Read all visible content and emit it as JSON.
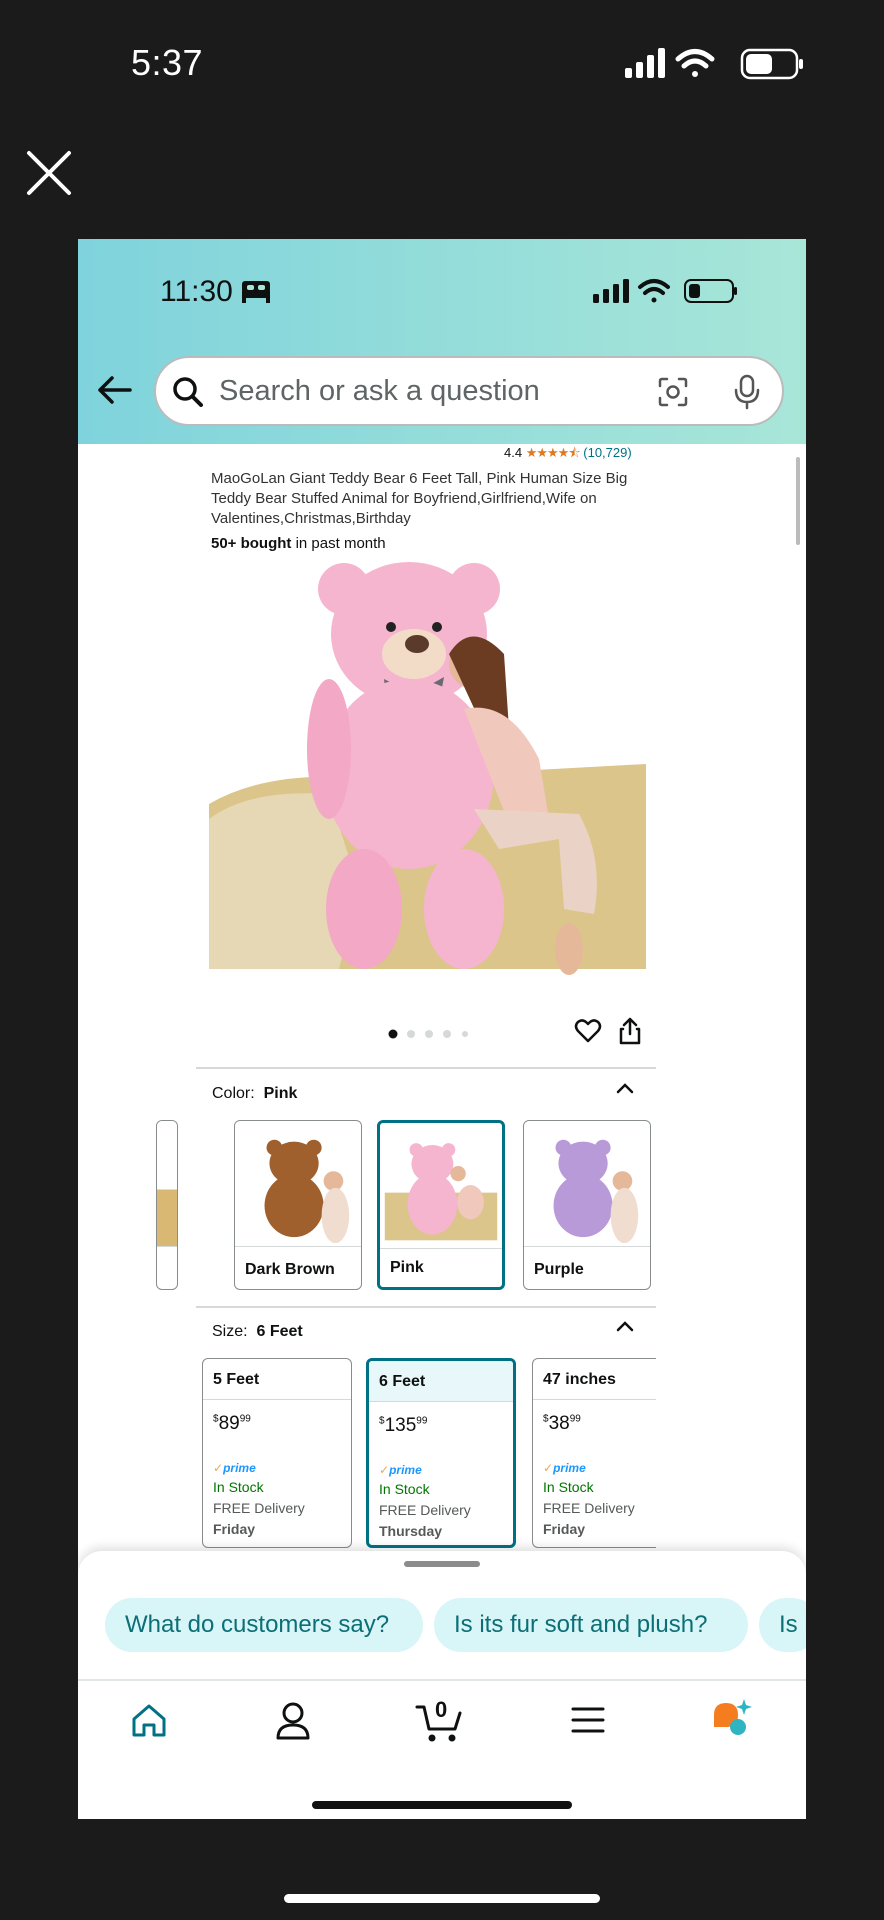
{
  "outer_status": {
    "time": "5:37"
  },
  "inner_status": {
    "time": "11:30"
  },
  "search": {
    "placeholder": "Search or ask a question"
  },
  "product": {
    "rating_value": "4.4",
    "rating_stars": "★★★★⯪",
    "rating_count": "(10,729)",
    "title": "MaoGoLan Giant Teddy Bear 6 Feet Tall, Pink Human Size Big Teddy Bear Stuffed Animal for Boyfriend,Girlfriend,Wife on Valentines,Christmas,Birthday",
    "bought_bold": "50+ bought",
    "bought_rest": " in past month",
    "image_pagination": {
      "total": 5,
      "current": 1
    }
  },
  "color": {
    "label": "Color:",
    "selected": "Pink",
    "options": [
      "Dark Brown",
      "Pink",
      "Purple"
    ]
  },
  "size": {
    "label": "Size:",
    "selected": "6 Feet",
    "options": [
      {
        "name": "5 Feet",
        "price_dollars": "89",
        "price_cents": "99",
        "prime": "prime",
        "stock": "In Stock",
        "delivery": "FREE Delivery",
        "day": "Friday"
      },
      {
        "name": "6 Feet",
        "price_dollars": "135",
        "price_cents": "99",
        "prime": "prime",
        "stock": "In Stock",
        "delivery": "FREE Delivery",
        "day": "Thursday"
      },
      {
        "name": "47 inches",
        "price_dollars": "38",
        "price_cents": "99",
        "prime": "prime",
        "stock": "In Stock",
        "delivery": "FREE Delivery",
        "day": "Friday"
      }
    ]
  },
  "questions": [
    "What do customers say?",
    "Is its fur soft and plush?",
    "Is it"
  ],
  "nav": {
    "items": [
      "home-icon",
      "account-icon",
      "cart-icon",
      "menu-icon",
      "rufus-icon"
    ],
    "cart_count": "0"
  },
  "colors": {
    "header_gradient_start": "#7fd3dc",
    "header_gradient_end": "#a8e6d8",
    "accent_teal": "#007185",
    "chip_bg": "#d8f5f7",
    "in_stock": "#007600",
    "star": "#de7921"
  }
}
